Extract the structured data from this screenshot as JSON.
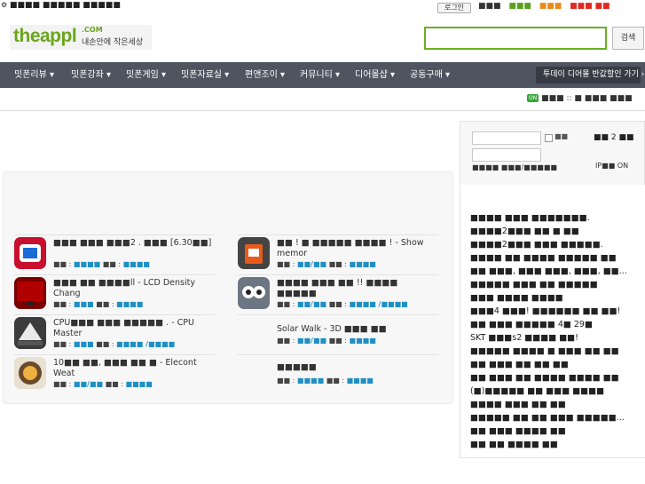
{
  "topbar": {
    "notice": "■■■■ ■■■■■ ■■■■■",
    "login_label": "로그인",
    "links": [
      {
        "label": "■■■",
        "color": "#333333"
      },
      {
        "label": "■■■",
        "color": "#5a9f22"
      },
      {
        "label": "■■■",
        "color": "#e88a1c"
      },
      {
        "label": "■■■ ■■",
        "color": "#e0281f"
      }
    ]
  },
  "header": {
    "logo_main": "theappl",
    "logo_com": ".COM",
    "logo_tagline": "내손안에 작은세상",
    "search_value": "",
    "search_button": "검색"
  },
  "nav": {
    "items": [
      "밋폰리뷰 ▾",
      "밋폰강좌 ▾",
      "밋폰게임 ▾",
      "밋폰자료실 ▾",
      "편앤조이 ▾",
      "커뮤니티 ▾",
      "디어몰샵 ▾",
      "공동구매 ▾"
    ],
    "promo": "투데이 디어몰 반값할인 가기  ›"
  },
  "status": {
    "badge": "ON",
    "text": "■■■ :: ■ ■■■ ■■■"
  },
  "login_panel": {
    "id_value": "",
    "pw_value": "",
    "remember": "■■",
    "login_button": "■■ 2 ■■",
    "join_links": "■■■■  ■■■/■■■■■",
    "ip_label": "IP■■ ON"
  },
  "apps": [
    {
      "title": "■■■ ■■■ ■■■2 . ■■■ [6.30■■]",
      "meta_a": "■■ : ",
      "link_a": "■■■■",
      "meta_b": "■■ : ",
      "link_b": "■■■■",
      "has_meta": true
    },
    {
      "title": "■■ ! ■ ■■■■■ ■■■■ ! - Show memor",
      "meta_a": "■■ : ",
      "link_a": "■■/■■",
      "meta_b": "■■ : ",
      "link_b": "■■■■",
      "has_meta": true
    },
    {
      "title": "■■■ ■■ ■■■■ll - LCD Density Chang",
      "meta_a": "■■ : ",
      "link_a": "■■■",
      "meta_b": "■■ : ",
      "link_b": "■■■■",
      "has_meta": true
    },
    {
      "title": "■■■■ ■■■ ■■ !! ■■■■ ■■■■■",
      "meta_a": "■■ : ",
      "link_a": "■■/■■",
      "meta_b": "■■ : ",
      "link_b": "■■■■ /■■■■",
      "has_meta": true
    },
    {
      "title": "CPU■■■ ■■■ ■■■■■ . - CPU Master",
      "meta_a": "■■ : ",
      "link_a": "■■■",
      "meta_b": "■■ : ",
      "link_b": "■■■■ /■■■■",
      "has_meta": true
    },
    {
      "title": "Solar Walk - 3D ■■■ ■■",
      "meta_a": "■■ : ",
      "link_a": "■■/■■",
      "meta_b": "■■ : ",
      "link_b": "■■■■",
      "has_meta": true
    },
    {
      "title": "10■■ ■■, ■■■ ■■ ■ - Elecont Weat",
      "meta_a": "■■ : ",
      "link_a": "■■/■■",
      "meta_b": "■■ : ",
      "link_b": "■■■■",
      "has_meta": true
    },
    {
      "title": "■■■■■",
      "meta_a": "■■ : ",
      "link_a": "■■■■",
      "meta_b": "■■ : ",
      "link_b": "■■■■",
      "has_meta": true
    }
  ],
  "rank_lines": [
    "■■■■ ■■■ ■■■■■■■.",
    "■■■■2■■■ ■■ ■ ■■",
    "■■■■2■■■ ■■■ ■■■■■.",
    "■■■■ ■■ ■■■■ ■■■■■ ■■",
    "■■ ■■■, ■■■ ■■■, ■■■, ■■...",
    "■■■■■ ■■■ ■■ ■■■■■",
    "■■■ ■■■■ ■■■■",
    "■■■4 ■■■! ■■■■■■ ■■ ■■!",
    "■■ ■■■ ■■■■■ 4■ 29■",
    "SKT ■■■s2 ■■■■ ■■!",
    "■■■■■ ■■■■ ■ ■■■ ■■ ■■",
    "■■ ■■■ ■■ ■■ ■■",
    "■■ ■■■ ■■ ■■■■ ■■■■ ■■",
    "(■)■■■■■ ■■ ■■■ ■■■■",
    "■■■■ ■■■ ■■ ■■",
    "■■■■■ ■■ ■■ ■■■ ■■■■■...",
    "■■ ■■■ ■■■■ ■■",
    "■■ ■■ ■■■■ ■■",
    "■■ ■■■■ ■■■"
  ],
  "colors": {
    "brand_green": "#6aa61b",
    "nav_bg": "#4e5560",
    "link_blue": "#1f8fc4"
  }
}
